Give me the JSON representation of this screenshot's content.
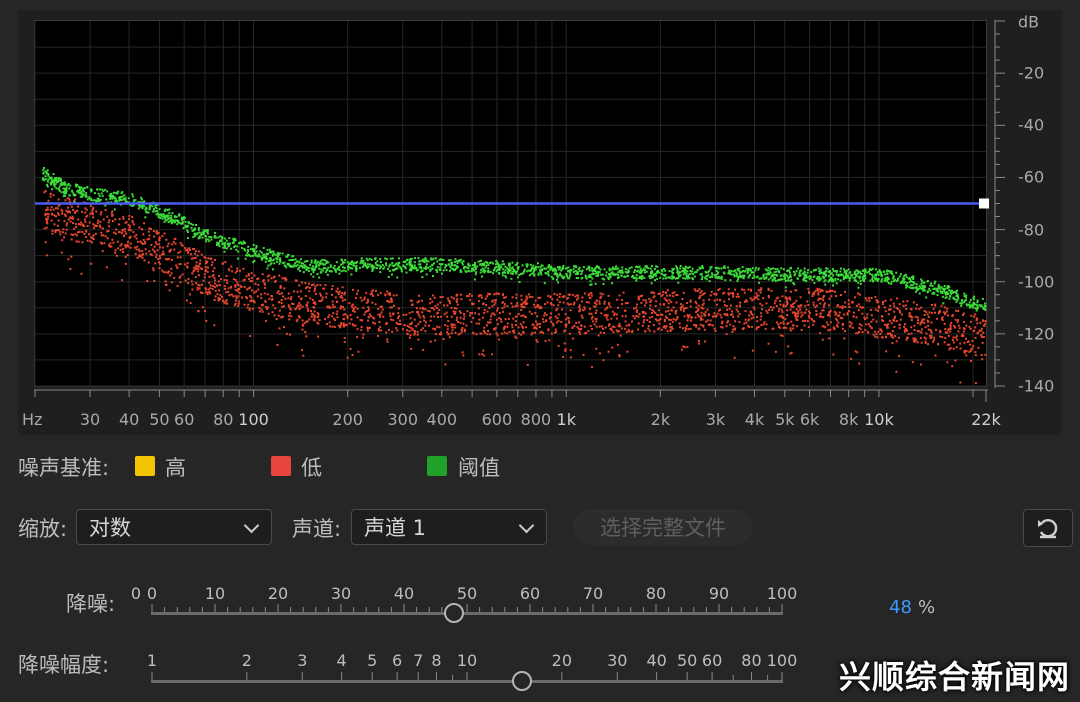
{
  "spectrum": {
    "x_axis": {
      "unit_label": "Hz",
      "ticks": [
        "30",
        "40",
        "50",
        "60",
        "80",
        "100",
        "200",
        "300",
        "400",
        "600",
        "800",
        "1k",
        "2k",
        "3k",
        "4k",
        "5k",
        "6k",
        "8k",
        "10k",
        "22k"
      ],
      "tick_values": [
        30,
        40,
        50,
        60,
        80,
        100,
        200,
        300,
        400,
        600,
        800,
        1000,
        2000,
        3000,
        4000,
        5000,
        6000,
        8000,
        10000,
        22000
      ],
      "major": [
        "100",
        "1k",
        "10k",
        "22k"
      ],
      "range_hz": [
        20,
        22000
      ],
      "scale": "log"
    },
    "y_axis": {
      "unit_label": "dB",
      "ticks": [
        "-20",
        "-40",
        "-60",
        "-80",
        "-100",
        "-120",
        "-140"
      ],
      "tick_values": [
        -20,
        -40,
        -60,
        -80,
        -100,
        -120,
        -140
      ],
      "range_db": [
        0,
        -140
      ]
    },
    "threshold_db": -70,
    "threshold_color": "#4a5cf0",
    "colors": {
      "green": "#3ddc3a",
      "red": "#e8472f",
      "background": "#000000"
    },
    "curves": {
      "threshold_green_profile": [
        [
          21,
          -58
        ],
        [
          25,
          -64
        ],
        [
          30,
          -66
        ],
        [
          40,
          -68
        ],
        [
          55,
          -75
        ],
        [
          70,
          -82
        ],
        [
          100,
          -88
        ],
        [
          150,
          -94
        ],
        [
          200,
          -93
        ],
        [
          400,
          -93
        ],
        [
          800,
          -95
        ],
        [
          1000,
          -96
        ],
        [
          3000,
          -96
        ],
        [
          6000,
          -97
        ],
        [
          10000,
          -97
        ],
        [
          15000,
          -102
        ],
        [
          22000,
          -109
        ]
      ],
      "low_red_profile": [
        [
          21,
          -72
        ],
        [
          30,
          -78
        ],
        [
          40,
          -82
        ],
        [
          60,
          -93
        ],
        [
          80,
          -100
        ],
        [
          100,
          -103
        ],
        [
          150,
          -108
        ],
        [
          300,
          -112
        ],
        [
          1000,
          -112
        ],
        [
          3000,
          -110
        ],
        [
          6000,
          -110
        ],
        [
          10000,
          -113
        ],
        [
          15000,
          -116
        ],
        [
          22000,
          -121
        ]
      ]
    }
  },
  "legend": {
    "title": "噪声基准:",
    "items": [
      {
        "label": "高",
        "color": "#f5c400"
      },
      {
        "label": "低",
        "color": "#e8453c"
      },
      {
        "label": "阈值",
        "color": "#1fa12a"
      }
    ]
  },
  "controls": {
    "scale_label": "缩放:",
    "scale_value": "对数",
    "channel_label": "声道:",
    "channel_value": "声道 1",
    "select_full_file": "选择完整文件",
    "reset_icon": "reset-icon"
  },
  "noise_reduction": {
    "label": "降噪:",
    "left_value": "0",
    "ticks": [
      "0",
      "10",
      "20",
      "30",
      "40",
      "50",
      "60",
      "70",
      "80",
      "90",
      "100"
    ],
    "value": "48",
    "unit": "%",
    "value_fraction": 0.48
  },
  "reduce_by": {
    "label": "降噪幅度:",
    "ticks": [
      "1",
      "2",
      "3",
      "4",
      "5",
      "6",
      "7",
      "8",
      "10",
      "20",
      "30",
      "40",
      "50",
      "60",
      "80",
      "100"
    ],
    "tick_values": [
      1,
      2,
      3,
      4,
      5,
      6,
      7,
      8,
      10,
      20,
      30,
      40,
      50,
      60,
      80,
      100
    ],
    "value_db": 15,
    "scale": "log"
  },
  "watermark": "兴顺综合新闻网"
}
